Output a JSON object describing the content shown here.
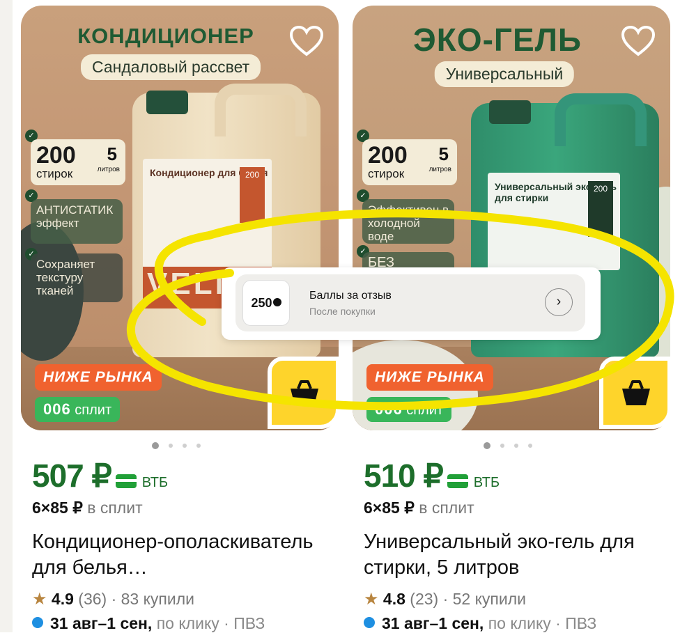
{
  "products": [
    {
      "image": {
        "headline": "КОНДИЦИОНЕР",
        "subtitle": "Сандаловый рассвет",
        "washes_number": "200",
        "washes_label": "стирок",
        "liters_number": "5",
        "liters_label": "литров",
        "feature_1": "АНТИСТАТИК эффект",
        "feature_2": "Сохраняет текстуру тканей",
        "label_title": "Кондиционер для белья",
        "label_number": "200",
        "brand_text": "VELN"
      },
      "promo_badge": "НИЖЕ РЫНКА",
      "split_badge": "006",
      "split_badge_suffix": "сплит",
      "price": "507 ₽",
      "bank": "ВТБ",
      "split_price": "6×85 ₽",
      "split_suffix": "в сплит",
      "name": "Кондиционер-ополаскиватель для белья…",
      "rating": "4.9",
      "reviews": "(36)",
      "bought": "· 83 купили",
      "delivery_date": "31 авг–1 сен,",
      "delivery_suffix": "по клику · ПВЗ"
    },
    {
      "image": {
        "headline": "ЭКО-ГЕЛЬ",
        "subtitle": "Универсальный",
        "washes_number": "200",
        "washes_label": "стирок",
        "liters_number": "5",
        "liters_label": "литров",
        "feature_1": "Эффективен в холодной воде",
        "feature_2": "БЕЗ фосфатов",
        "label_title": "Универсальный эко-гель для стирки",
        "label_number": "200"
      },
      "promo_badge": "НИЖЕ РЫНКА",
      "split_badge": "006",
      "split_badge_suffix": "сплит",
      "price": "510 ₽",
      "bank": "ВТБ",
      "split_price": "6×85 ₽",
      "split_suffix": "в сплит",
      "name": "Универсальный эко-гель для стирки, 5 литров",
      "rating": "4.8",
      "reviews": "(23)",
      "bought": "· 52 купили",
      "delivery_date": "31 авг–1 сен,",
      "delivery_suffix": "по клику · ПВЗ"
    }
  ],
  "review_popup": {
    "points": "250",
    "title": "Баллы за отзыв",
    "subtitle": "После покупки",
    "arrow": "›"
  },
  "icons": {
    "favorite": "heart-icon",
    "cart": "basket-icon",
    "rating": "star-icon",
    "delivery": "dot-icon",
    "next": "chevron-right-icon"
  },
  "colors": {
    "price_green": "#1d6e2b",
    "promo_orange": "#f0622f",
    "split_green": "#39b65a",
    "cart_yellow": "#fed42b",
    "highlight_yellow": "#f5e400"
  }
}
